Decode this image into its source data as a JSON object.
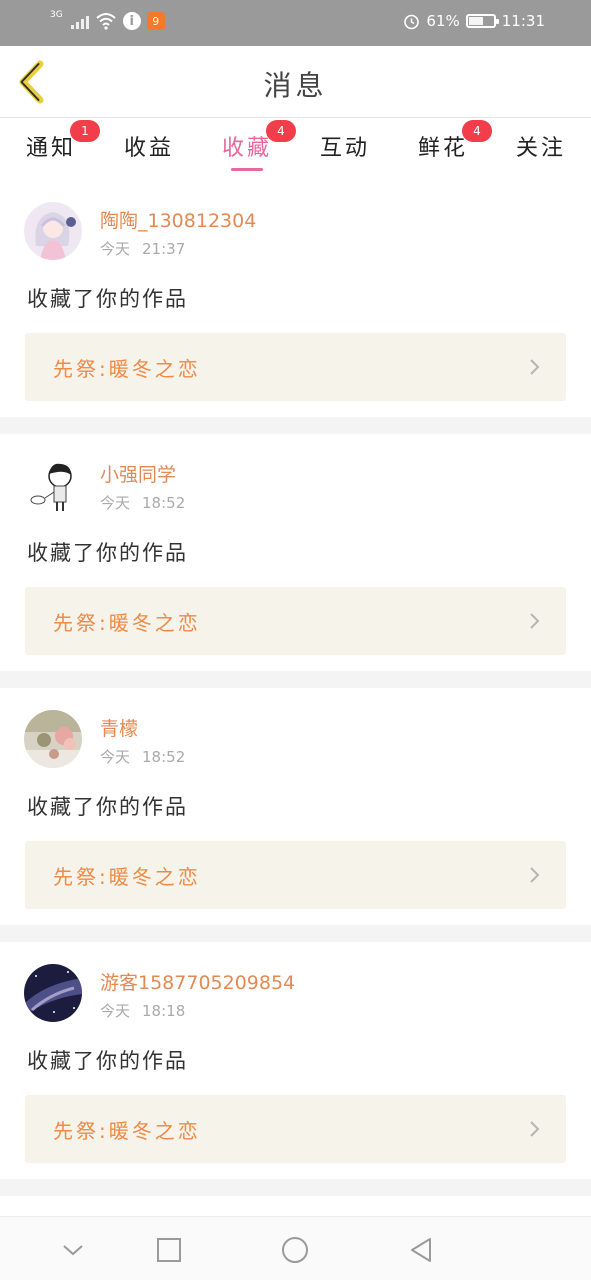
{
  "status_bar": {
    "network": "3G",
    "battery_percent": "61%",
    "battery_level": 0.61,
    "time": "11:31",
    "app_icon_label": "9"
  },
  "header": {
    "title": "消息"
  },
  "tabs": [
    {
      "label": "通知",
      "badge": "1"
    },
    {
      "label": "收益",
      "badge": ""
    },
    {
      "label": "收藏",
      "badge": "4",
      "active": true
    },
    {
      "label": "互动",
      "badge": ""
    },
    {
      "label": "鲜花",
      "badge": "4"
    },
    {
      "label": "关注",
      "badge": ""
    }
  ],
  "messages": [
    {
      "username": "陶陶_130812304",
      "day": "今天",
      "time": "21:37",
      "text": "收藏了你的作品",
      "work_title": "先祭:暖冬之恋",
      "avatar": "anime-girl-avatar"
    },
    {
      "username": "小强同学",
      "day": "今天",
      "time": "18:52",
      "text": "收藏了你的作品",
      "work_title": "先祭:暖冬之恋",
      "avatar": "cartoon-boy-avatar"
    },
    {
      "username": "青檬",
      "day": "今天",
      "time": "18:52",
      "text": "收藏了你的作品",
      "work_title": "先祭:暖冬之恋",
      "avatar": "flowers-photo-avatar"
    },
    {
      "username": "游客1587705209854",
      "day": "今天",
      "time": "18:18",
      "text": "收藏了你的作品",
      "work_title": "先祭:暖冬之恋",
      "avatar": "galaxy-avatar"
    }
  ],
  "colors": {
    "accent": "#e8679c",
    "username": "#e38a54",
    "work_title": "#ef8a47",
    "badge": "#f23e4a",
    "back_arrow": "#e9cf3c"
  }
}
